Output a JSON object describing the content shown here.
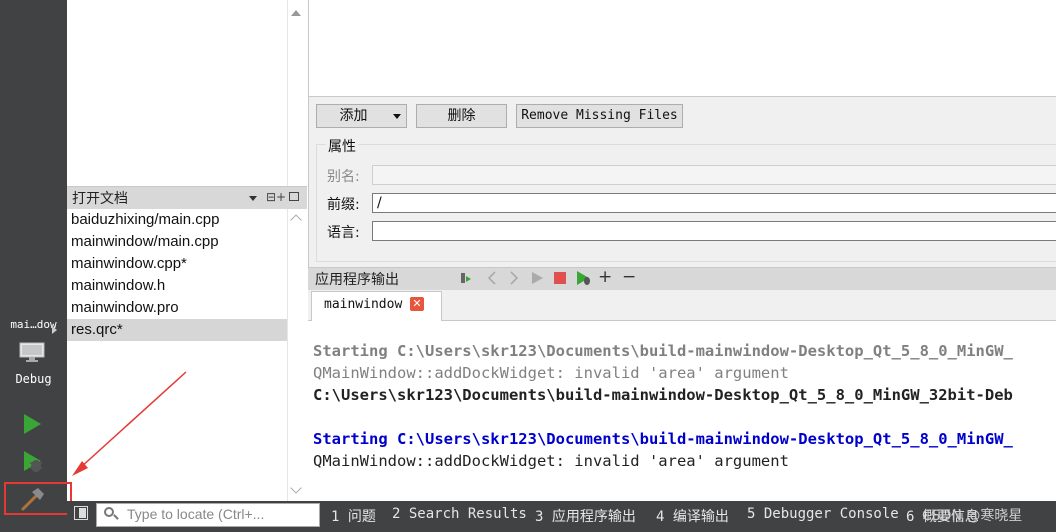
{
  "mode_bar": {
    "kit_label": "mai…dow",
    "mode_label": "Debug",
    "icons": [
      "monitor-icon",
      "run-icon",
      "debug-run-icon",
      "build-hammer-icon"
    ]
  },
  "open_documents": {
    "title": "打开文档",
    "items": [
      {
        "label": "baiduzhixing/main.cpp"
      },
      {
        "label": "mainwindow/main.cpp"
      },
      {
        "label": "mainwindow.cpp*"
      },
      {
        "label": "mainwindow.h"
      },
      {
        "label": "mainwindow.pro"
      },
      {
        "label": "res.qrc*",
        "selected": true
      }
    ]
  },
  "resource_editor": {
    "add_button": "添加",
    "delete_button": "删除",
    "remove_missing_button": "Remove Missing Files",
    "properties_title": "属性",
    "alias_label": "别名:",
    "alias_value": "",
    "prefix_label": "前缀:",
    "prefix_value": "/",
    "language_label": "语言:",
    "language_value": ""
  },
  "app_output": {
    "title": "应用程序输出",
    "toolbar_icons": [
      "attach-icon",
      "prev-icon",
      "next-icon",
      "run-icon",
      "stop-icon",
      "debug-run-icon",
      "zoom-in-icon",
      "zoom-out-icon"
    ],
    "zoom_in": "+",
    "zoom_out": "−",
    "tab_label": "mainwindow",
    "lines": [
      "Starting C:\\Users\\skr123\\Documents\\build-mainwindow-Desktop_Qt_5_8_0_MinGW_",
      "QMainWindow::addDockWidget: invalid 'area' argument",
      "C:\\Users\\skr123\\Documents\\build-mainwindow-Desktop_Qt_5_8_0_MinGW_32bit-Deb",
      "Starting C:\\Users\\skr123\\Documents\\build-mainwindow-Desktop_Qt_5_8_0_MinGW_",
      "QMainWindow::addDockWidget: invalid 'area' argument"
    ]
  },
  "status_bar": {
    "locator_placeholder": "Type to locate (Ctrl+...",
    "tabs": [
      "1 问题",
      "2 Search Results",
      "3 应用程序输出",
      "4 编译输出",
      "5 Debugger Console",
      "6 概要信息"
    ],
    "watermark": "CSDN @寒晓星"
  },
  "colors": {
    "mode_bar_bg": "#404244",
    "annotation_red": "#e53935",
    "output_blue": "#0000cc",
    "run_green": "#3aa635"
  }
}
